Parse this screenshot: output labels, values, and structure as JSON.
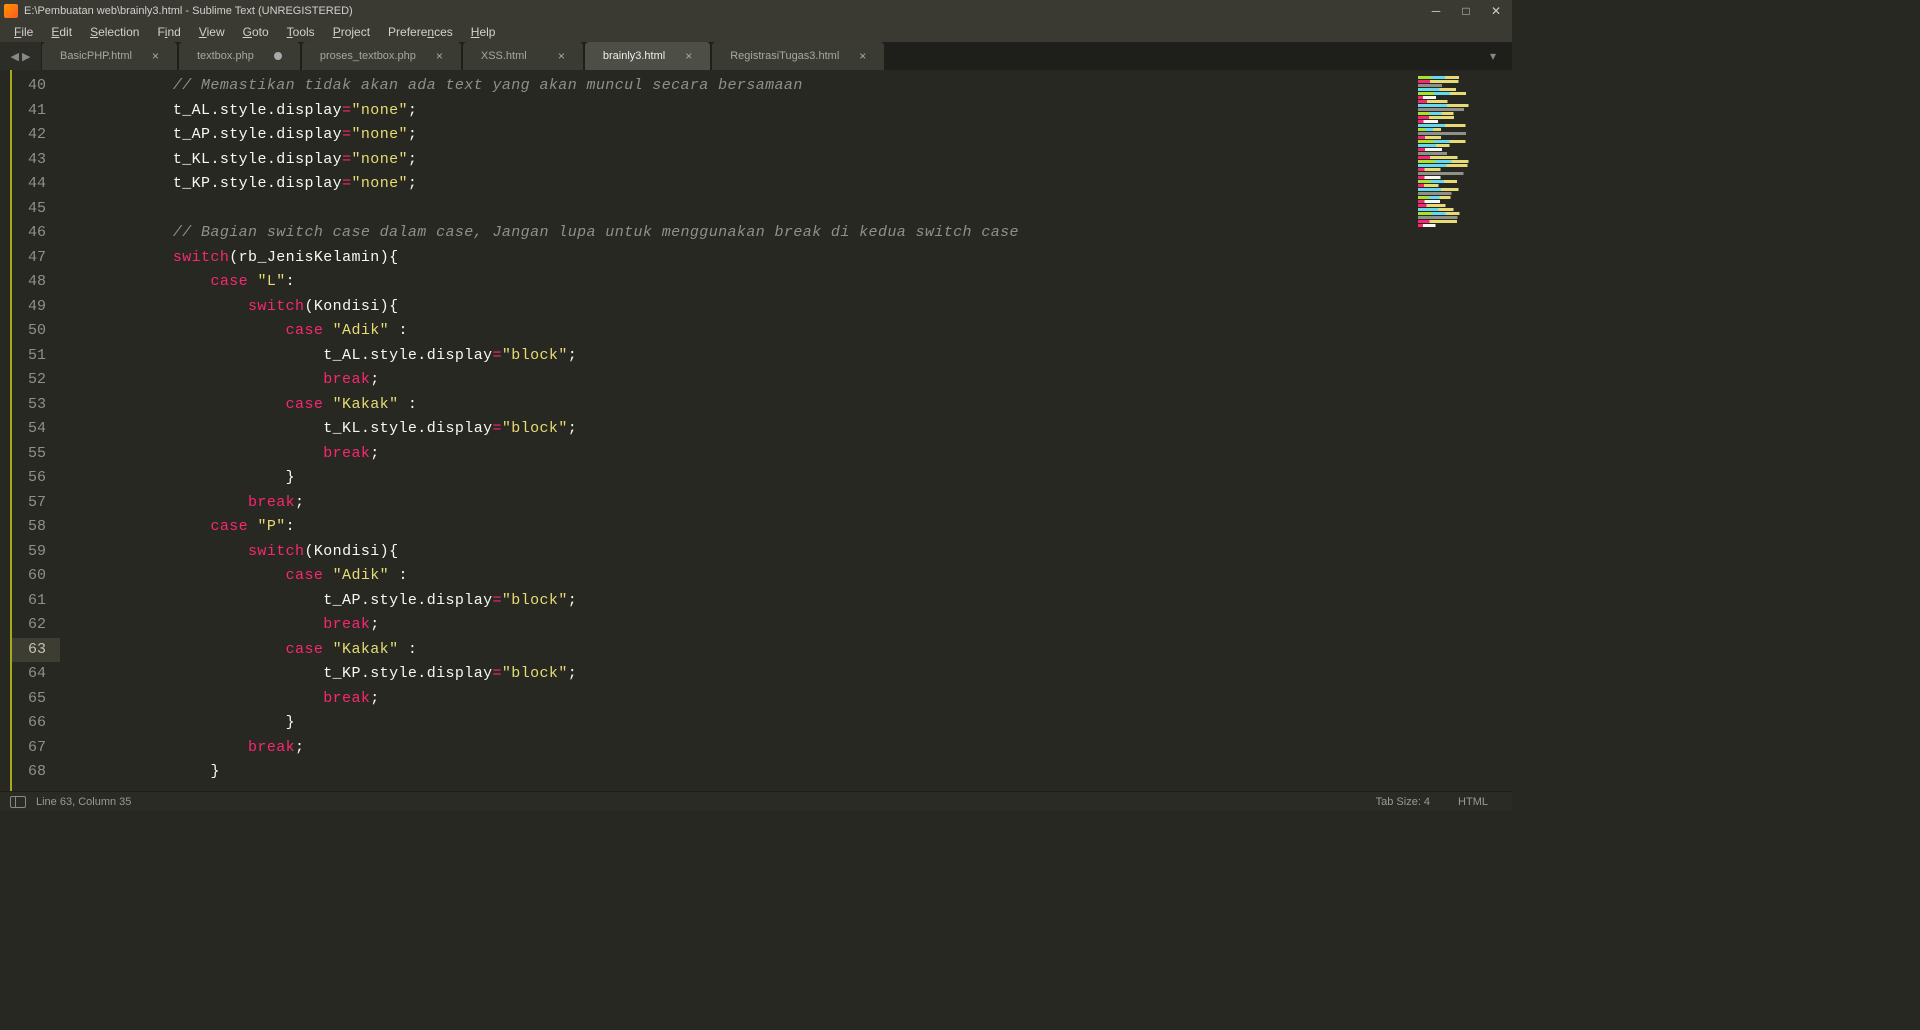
{
  "window": {
    "title": "E:\\Pembuatan web\\brainly3.html - Sublime Text (UNREGISTERED)"
  },
  "menu": {
    "file": "File",
    "edit": "Edit",
    "selection": "Selection",
    "find": "Find",
    "view": "View",
    "goto": "Goto",
    "tools": "Tools",
    "project": "Project",
    "preferences": "Preferences",
    "help": "Help"
  },
  "tabs": [
    {
      "label": "BasicPHP.html",
      "active": false,
      "dirty": false
    },
    {
      "label": "textbox.php",
      "active": false,
      "dirty": true
    },
    {
      "label": "proses_textbox.php",
      "active": false,
      "dirty": false
    },
    {
      "label": "XSS.html",
      "active": false,
      "dirty": false
    },
    {
      "label": "brainly3.html",
      "active": true,
      "dirty": false
    },
    {
      "label": "RegistrasiTugas3.html",
      "active": false,
      "dirty": false
    }
  ],
  "gutter": {
    "start": 40,
    "end": 68,
    "current": 63
  },
  "code": {
    "lines": [
      {
        "n": 40,
        "indent": 12,
        "tokens": [
          {
            "t": "comment",
            "v": "// Memastikan tidak akan ada text yang akan muncul secara bersamaan"
          }
        ]
      },
      {
        "n": 41,
        "indent": 12,
        "tokens": [
          {
            "t": "ident",
            "v": "t_AL"
          },
          {
            "t": "punc",
            "v": "."
          },
          {
            "t": "ident",
            "v": "style"
          },
          {
            "t": "punc",
            "v": "."
          },
          {
            "t": "ident",
            "v": "display"
          },
          {
            "t": "op",
            "v": "="
          },
          {
            "t": "string",
            "v": "\"none\""
          },
          {
            "t": "punc",
            "v": ";"
          }
        ]
      },
      {
        "n": 42,
        "indent": 12,
        "tokens": [
          {
            "t": "ident",
            "v": "t_AP"
          },
          {
            "t": "punc",
            "v": "."
          },
          {
            "t": "ident",
            "v": "style"
          },
          {
            "t": "punc",
            "v": "."
          },
          {
            "t": "ident",
            "v": "display"
          },
          {
            "t": "op",
            "v": "="
          },
          {
            "t": "string",
            "v": "\"none\""
          },
          {
            "t": "punc",
            "v": ";"
          }
        ]
      },
      {
        "n": 43,
        "indent": 12,
        "tokens": [
          {
            "t": "ident",
            "v": "t_KL"
          },
          {
            "t": "punc",
            "v": "."
          },
          {
            "t": "ident",
            "v": "style"
          },
          {
            "t": "punc",
            "v": "."
          },
          {
            "t": "ident",
            "v": "display"
          },
          {
            "t": "op",
            "v": "="
          },
          {
            "t": "string",
            "v": "\"none\""
          },
          {
            "t": "punc",
            "v": ";"
          }
        ]
      },
      {
        "n": 44,
        "indent": 12,
        "tokens": [
          {
            "t": "ident",
            "v": "t_KP"
          },
          {
            "t": "punc",
            "v": "."
          },
          {
            "t": "ident",
            "v": "style"
          },
          {
            "t": "punc",
            "v": "."
          },
          {
            "t": "ident",
            "v": "display"
          },
          {
            "t": "op",
            "v": "="
          },
          {
            "t": "string",
            "v": "\"none\""
          },
          {
            "t": "punc",
            "v": ";"
          }
        ]
      },
      {
        "n": 45,
        "indent": 0,
        "tokens": []
      },
      {
        "n": 46,
        "indent": 12,
        "tokens": [
          {
            "t": "comment",
            "v": "// Bagian switch case dalam case, Jangan lupa untuk menggunakan break di kedua switch case"
          }
        ]
      },
      {
        "n": 47,
        "indent": 12,
        "tokens": [
          {
            "t": "keyword",
            "v": "switch"
          },
          {
            "t": "punc",
            "v": "("
          },
          {
            "t": "ident",
            "v": "rb_JenisKelamin"
          },
          {
            "t": "punc",
            "v": "){"
          }
        ]
      },
      {
        "n": 48,
        "indent": 16,
        "tokens": [
          {
            "t": "keyword",
            "v": "case"
          },
          {
            "t": "ident",
            "v": " "
          },
          {
            "t": "string",
            "v": "\"L\""
          },
          {
            "t": "punc",
            "v": ":"
          }
        ]
      },
      {
        "n": 49,
        "indent": 20,
        "tokens": [
          {
            "t": "keyword",
            "v": "switch"
          },
          {
            "t": "punc",
            "v": "("
          },
          {
            "t": "ident",
            "v": "Kondisi"
          },
          {
            "t": "punc",
            "v": "){"
          }
        ]
      },
      {
        "n": 50,
        "indent": 24,
        "tokens": [
          {
            "t": "keyword",
            "v": "case"
          },
          {
            "t": "ident",
            "v": " "
          },
          {
            "t": "string",
            "v": "\"Adik\""
          },
          {
            "t": "ident",
            "v": " "
          },
          {
            "t": "punc",
            "v": ":"
          }
        ]
      },
      {
        "n": 51,
        "indent": 28,
        "tokens": [
          {
            "t": "ident",
            "v": "t_AL"
          },
          {
            "t": "punc",
            "v": "."
          },
          {
            "t": "ident",
            "v": "style"
          },
          {
            "t": "punc",
            "v": "."
          },
          {
            "t": "ident",
            "v": "display"
          },
          {
            "t": "op",
            "v": "="
          },
          {
            "t": "string",
            "v": "\"block\""
          },
          {
            "t": "punc",
            "v": ";"
          }
        ]
      },
      {
        "n": 52,
        "indent": 28,
        "tokens": [
          {
            "t": "break",
            "v": "break"
          },
          {
            "t": "punc",
            "v": ";"
          }
        ]
      },
      {
        "n": 53,
        "indent": 24,
        "tokens": [
          {
            "t": "keyword",
            "v": "case"
          },
          {
            "t": "ident",
            "v": " "
          },
          {
            "t": "string",
            "v": "\"Kakak\""
          },
          {
            "t": "ident",
            "v": " "
          },
          {
            "t": "punc",
            "v": ":"
          }
        ]
      },
      {
        "n": 54,
        "indent": 28,
        "tokens": [
          {
            "t": "ident",
            "v": "t_KL"
          },
          {
            "t": "punc",
            "v": "."
          },
          {
            "t": "ident",
            "v": "style"
          },
          {
            "t": "punc",
            "v": "."
          },
          {
            "t": "ident",
            "v": "display"
          },
          {
            "t": "op",
            "v": "="
          },
          {
            "t": "string",
            "v": "\"block\""
          },
          {
            "t": "punc",
            "v": ";"
          }
        ]
      },
      {
        "n": 55,
        "indent": 28,
        "tokens": [
          {
            "t": "break",
            "v": "break"
          },
          {
            "t": "punc",
            "v": ";"
          }
        ]
      },
      {
        "n": 56,
        "indent": 24,
        "tokens": [
          {
            "t": "punc",
            "v": "}"
          }
        ]
      },
      {
        "n": 57,
        "indent": 20,
        "tokens": [
          {
            "t": "break",
            "v": "break"
          },
          {
            "t": "punc",
            "v": ";"
          }
        ]
      },
      {
        "n": 58,
        "indent": 16,
        "tokens": [
          {
            "t": "keyword",
            "v": "case"
          },
          {
            "t": "ident",
            "v": " "
          },
          {
            "t": "string",
            "v": "\"P\""
          },
          {
            "t": "punc",
            "v": ":"
          }
        ]
      },
      {
        "n": 59,
        "indent": 20,
        "tokens": [
          {
            "t": "keyword",
            "v": "switch"
          },
          {
            "t": "punc",
            "v": "("
          },
          {
            "t": "ident",
            "v": "Kondisi"
          },
          {
            "t": "punc",
            "v": "){"
          }
        ]
      },
      {
        "n": 60,
        "indent": 24,
        "tokens": [
          {
            "t": "keyword",
            "v": "case"
          },
          {
            "t": "ident",
            "v": " "
          },
          {
            "t": "string",
            "v": "\"Adik\""
          },
          {
            "t": "ident",
            "v": " "
          },
          {
            "t": "punc",
            "v": ":"
          }
        ]
      },
      {
        "n": 61,
        "indent": 28,
        "tokens": [
          {
            "t": "ident",
            "v": "t_AP"
          },
          {
            "t": "punc",
            "v": "."
          },
          {
            "t": "ident",
            "v": "style"
          },
          {
            "t": "punc",
            "v": "."
          },
          {
            "t": "ident",
            "v": "display"
          },
          {
            "t": "op",
            "v": "="
          },
          {
            "t": "string",
            "v": "\"block\""
          },
          {
            "t": "punc",
            "v": ";"
          }
        ]
      },
      {
        "n": 62,
        "indent": 28,
        "tokens": [
          {
            "t": "break",
            "v": "break"
          },
          {
            "t": "punc",
            "v": ";"
          }
        ]
      },
      {
        "n": 63,
        "indent": 24,
        "tokens": [
          {
            "t": "keyword",
            "v": "case"
          },
          {
            "t": "ident",
            "v": " "
          },
          {
            "t": "string",
            "v": "\"Kakak\""
          },
          {
            "t": "ident",
            "v": " "
          },
          {
            "t": "punc",
            "v": ":"
          }
        ]
      },
      {
        "n": 64,
        "indent": 28,
        "tokens": [
          {
            "t": "ident",
            "v": "t_KP"
          },
          {
            "t": "punc",
            "v": "."
          },
          {
            "t": "ident",
            "v": "style"
          },
          {
            "t": "punc",
            "v": "."
          },
          {
            "t": "ident",
            "v": "display"
          },
          {
            "t": "op",
            "v": "="
          },
          {
            "t": "string",
            "v": "\"block\""
          },
          {
            "t": "punc",
            "v": ";"
          }
        ]
      },
      {
        "n": 65,
        "indent": 28,
        "tokens": [
          {
            "t": "break",
            "v": "break"
          },
          {
            "t": "punc",
            "v": ";"
          }
        ]
      },
      {
        "n": 66,
        "indent": 24,
        "tokens": [
          {
            "t": "punc",
            "v": "}"
          }
        ]
      },
      {
        "n": 67,
        "indent": 20,
        "tokens": [
          {
            "t": "break",
            "v": "break"
          },
          {
            "t": "punc",
            "v": ";"
          }
        ]
      },
      {
        "n": 68,
        "indent": 16,
        "tokens": [
          {
            "t": "punc",
            "v": "}"
          }
        ]
      }
    ]
  },
  "status": {
    "cursor": "Line 63, Column 35",
    "tabsize": "Tab Size: 4",
    "syntax": "HTML"
  }
}
